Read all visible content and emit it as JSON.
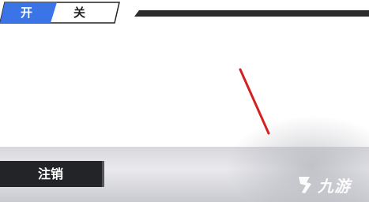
{
  "toggle": {
    "on_label": "开",
    "off_label": "关",
    "active": "on"
  },
  "footer": {
    "logout_label": "注销"
  },
  "watermark": {
    "text": "九游"
  },
  "colors": {
    "toggle_active": "#3a74e6",
    "header_rule": "#2b2b2b",
    "logout_bg": "#232428",
    "pointer": "#d42020"
  }
}
